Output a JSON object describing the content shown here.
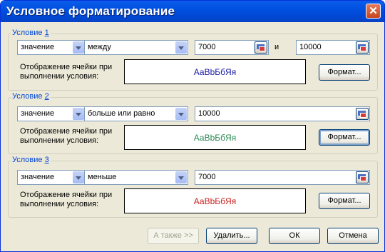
{
  "window": {
    "title": "Условное форматирование",
    "close_glyph": "✕"
  },
  "conditions": [
    {
      "label": "Условие",
      "num": "1",
      "type": "значение",
      "operator": "между",
      "value1": "7000",
      "and_label": "и",
      "value2": "10000",
      "preview_label_1": "Отображение ячейки при",
      "preview_label_2": "выполнении условия:",
      "preview_text": "АаВbБбЯя",
      "preview_color": "#1c1ca6",
      "format_button": "Формат..."
    },
    {
      "label": "Условие",
      "num": "2",
      "type": "значение",
      "operator": "больше или равно",
      "value1": "10000",
      "preview_label_1": "Отображение ячейки при",
      "preview_label_2": "выполнении условия:",
      "preview_text": "АаВbБбЯя",
      "preview_color": "#2e8b57",
      "format_button": "Формат..."
    },
    {
      "label": "Условие",
      "num": "3",
      "type": "значение",
      "operator": "меньше",
      "value1": "7000",
      "preview_label_1": "Отображение ячейки при",
      "preview_label_2": "выполнении условия:",
      "preview_text": "АаВbБбЯя",
      "preview_color": "#cc1f1f",
      "format_button": "Формат..."
    }
  ],
  "footer": {
    "also_button": "А также >>",
    "delete_button": "Удалить...",
    "ok_button": "ОК",
    "cancel_button": "Отмена"
  }
}
